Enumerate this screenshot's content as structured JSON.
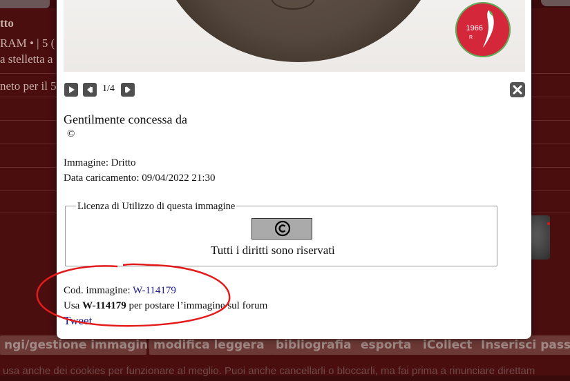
{
  "background_page": {
    "lines": [
      {
        "text": "tto",
        "bold": true
      },
      {
        "text": "RAM • | 5 ("
      },
      {
        "text": "a stelletta a"
      },
      {
        "text": "neto per il 5"
      }
    ],
    "bottom_buttons": [
      "ngi/gestione immagini",
      "modifica leggera",
      "bibliografia",
      "esporta",
      "iCollect",
      "Inserisci pass"
    ],
    "cookie_notice": "usa anche dei cookies per funzionare al meglio. Puoi anche cancellarli o bloccarli, ma fai prima a rinunciare direttam"
  },
  "viewer": {
    "logo_year": "1966",
    "logo_letter": "R",
    "play_label": "play-icon",
    "prev_label": "previous-icon",
    "next_label": "next-icon",
    "close_label": "close-icon",
    "counter": "1/4"
  },
  "details": {
    "credit_title": "Gentilmente concessa da",
    "copyright_symbol": "©",
    "image_label": "Immagine: Dritto",
    "upload_date": "Data caricamento: 09/04/2022 21:30"
  },
  "license": {
    "legend": "Licenza di Utilizzo di questa immagine",
    "badge_icon": "copyright-icon",
    "rights_text": "Tutti i diritti sono riservati"
  },
  "code_info": {
    "label": "Cod. immagine: ",
    "code": "W-114179",
    "usage_prefix": "Usa ",
    "usage_code": "W-114179",
    "usage_suffix": " per postare l’immagine sul forum",
    "tweet": "Tweet"
  },
  "colors": {
    "annotation_red": "#e31b1b",
    "link_blue": "#1a1a8a",
    "logo_red": "#d4273a"
  }
}
